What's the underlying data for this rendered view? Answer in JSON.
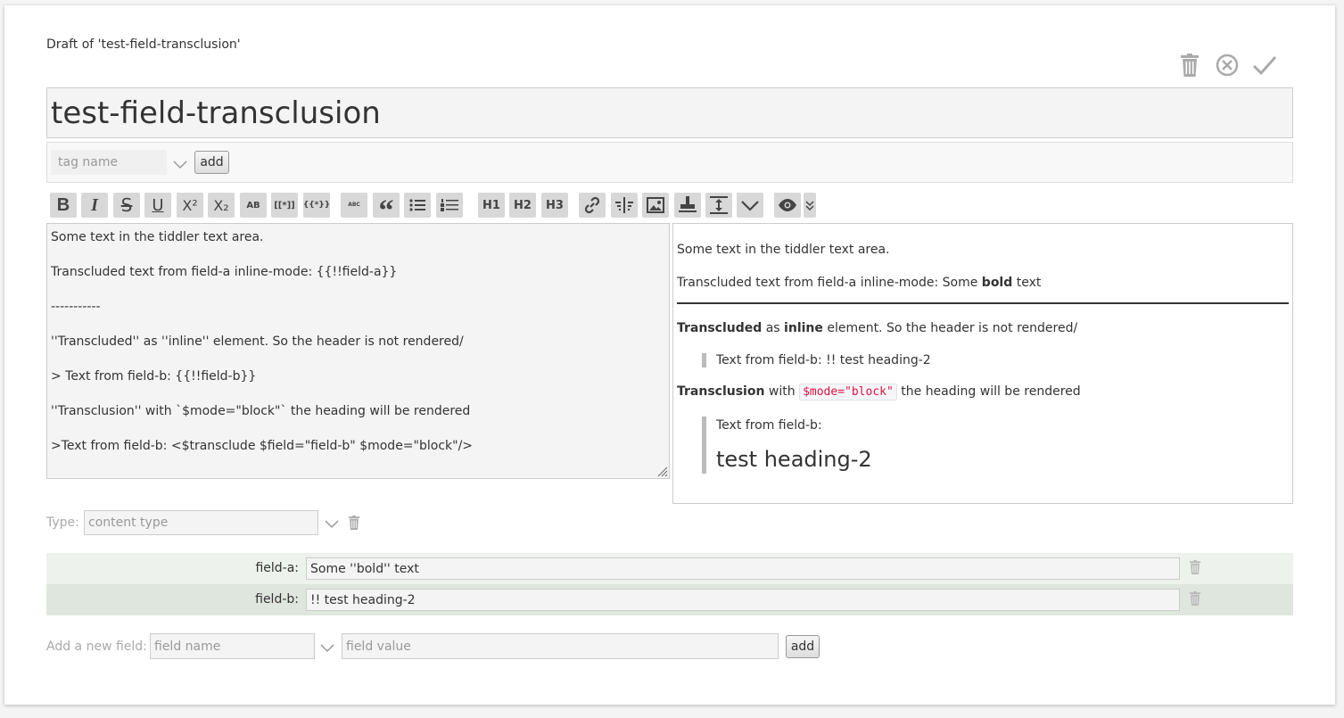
{
  "draft_title": "Draft of 'test-field-transclusion'",
  "title_value": "test-field-transclusion",
  "tags": {
    "placeholder": "tag name",
    "add_label": "add"
  },
  "toolbar": {
    "buttons": [
      {
        "name": "bold",
        "glyph": "B"
      },
      {
        "name": "italic",
        "glyph": "I"
      },
      {
        "name": "strikethrough",
        "glyph": "S"
      },
      {
        "name": "underline",
        "glyph": "U"
      },
      {
        "name": "superscript",
        "glyph": "X²"
      },
      {
        "name": "subscript",
        "glyph": "X₂"
      },
      {
        "name": "smallcaps",
        "glyph": "AB"
      },
      {
        "name": "linkify",
        "glyph": "[[*]]"
      },
      {
        "name": "transcludify",
        "glyph": "{{*}}"
      },
      {
        "name": "mono-block",
        "glyph": "ABC"
      },
      {
        "name": "quote",
        "glyph": "“"
      },
      {
        "name": "list-bullet",
        "glyph": "•"
      },
      {
        "name": "list-number",
        "glyph": "1."
      },
      {
        "name": "heading-1",
        "glyph": "H1"
      },
      {
        "name": "heading-2",
        "glyph": "H2"
      },
      {
        "name": "heading-3",
        "glyph": "H3"
      }
    ]
  },
  "editor": {
    "lines": [
      "Some text in the tiddler text area.",
      "Transcluded text from field-a inline-mode: {{!!field-a}}",
      "-----------",
      "''Transcluded'' as ''inline'' element. So the header is not rendered/",
      "> Text from field-b: {{!!field-b}}",
      "''Transclusion'' with `$mode=\"block\"` the heading will be rendered",
      ">Text from field-b: <$transclude $field=\"field-b\" $mode=\"block\"/>"
    ]
  },
  "preview": {
    "p1": "Some text in the tiddler text area.",
    "p2_pre": "Transcluded text from field-a inline-mode: Some ",
    "p2_bold": "bold",
    "p2_post": " text",
    "p3_b1": "Transcluded",
    "p3_mid": " as ",
    "p3_b2": "inline",
    "p3_post": " element. So the header is not rendered/",
    "quote1": "Text from field-b: !! test heading-2",
    "p4_b": "Transclusion",
    "p4_mid": " with ",
    "p4_code": "$mode=\"block\"",
    "p4_post": " the heading will be rendered",
    "quote2_text": "Text from field-b:",
    "quote2_heading": "test heading-2"
  },
  "type": {
    "label": "Type:",
    "placeholder": "content type"
  },
  "fields": [
    {
      "name": "field-a:",
      "value": "Some ''bold'' text"
    },
    {
      "name": "field-b:",
      "value": "!! test heading-2"
    }
  ],
  "new_field": {
    "label": "Add a new field:",
    "name_placeholder": "field name",
    "value_placeholder": "field value",
    "add_label": "add"
  },
  "icons": [
    "delete-icon",
    "cancel-icon",
    "done-icon",
    "chevron-down-icon",
    "link-icon",
    "excise-icon",
    "picture-icon",
    "stamp-icon",
    "size-icon",
    "more-icon",
    "preview-icon",
    "preview-type-icon"
  ]
}
